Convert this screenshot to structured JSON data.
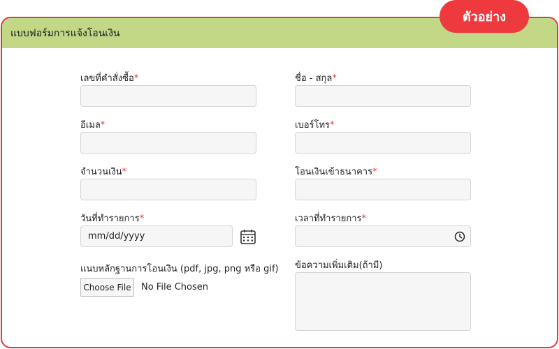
{
  "header": {
    "title": "แบบฟอร์มการแจ้งโอนเงิน",
    "badge": "ตัวอย่าง"
  },
  "form": {
    "required_mark": "*",
    "order_number": {
      "label": "เลขที่คำสั่งซื้อ",
      "value": ""
    },
    "full_name": {
      "label": "ชื่อ - สกุล",
      "value": ""
    },
    "email": {
      "label": "อีเมล",
      "value": ""
    },
    "phone": {
      "label": "เบอร์โทร",
      "value": ""
    },
    "amount": {
      "label": "จำนวนเงิน",
      "value": ""
    },
    "bank": {
      "label": "โอนเงินเข้าธนาคาร",
      "value": ""
    },
    "transaction_date": {
      "label": "วันที่ทำรายการ",
      "value": "mm/dd/yyyy",
      "icon": "calendar-icon"
    },
    "transaction_time": {
      "label": "เวลาที่ทำรายการ",
      "value": "",
      "icon": "clock-icon"
    },
    "attachment": {
      "label": "แนบหลักฐานการโอนเงิน (pdf, jpg, png หรือ gif)",
      "button_label": "Choose File",
      "status": "No File Chosen"
    },
    "note": {
      "label": "ข้อความเพิ่มเติม(ถ้ามี)",
      "value": ""
    }
  },
  "colors": {
    "header_bg": "#c2d887",
    "accent": "#ee3a3f",
    "border": "#e03a3e"
  }
}
